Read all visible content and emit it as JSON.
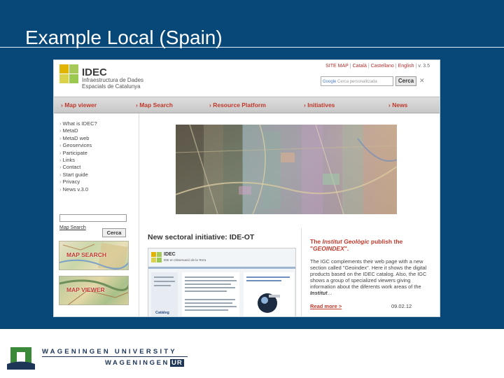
{
  "slide": {
    "title": "Example Local (Spain)"
  },
  "site": {
    "logo": {
      "name": "IDEC",
      "line1": "Infraestructura de Dades",
      "line2": "Espacials de Catalunya"
    },
    "top_links": [
      "SITE MAP",
      "Català",
      "Castellano",
      "English",
      "v. 3.5"
    ],
    "search": {
      "google": "Google",
      "placeholder": "Cerca personalitzada",
      "button": "Cerca"
    },
    "nav": [
      "Map viewer",
      "Map Search",
      "Resource Platform",
      "Initiatives",
      "News"
    ],
    "menu": [
      "What is IDEC?",
      "MetaD",
      "MetaD web",
      "Geoservices",
      "Participate",
      "Links",
      "Contact",
      "Start guide",
      "Privacy",
      "News v.3.0"
    ],
    "left": {
      "map_search_link": "Map Search",
      "search_button": "Cerca"
    },
    "banners": {
      "map_search": "MAP SEARCH",
      "map_viewer": "MAP VIEWER"
    },
    "news_left": {
      "title": "New sectoral initiative: IDE-OT",
      "thumb_logo": "IDEC",
      "thumb_sub": "IDE en Observació de la Terra",
      "thumb_catalog": "Catàleg"
    },
    "news_right": {
      "title_pre": "The ",
      "title_em": "Institut Geològic",
      "title_mid": " publish the \"",
      "title_em2": "GEOINDEX",
      "title_end": "\".",
      "body_1": "The IGC complements their web page with a new section called \"Geoindex\". Here it shows the digital products based on the IDEC catalog. Also, the IGC shows a group of specialized viewers giving information about the diferents work areas of the ",
      "body_em": "Institut",
      "body_2": "…",
      "more": "Read more >",
      "date": "09.02.12"
    }
  },
  "footer": {
    "line1": "WAGENINGEN UNIVERSITY",
    "line2": "WAGENINGEN",
    "ur": "UR"
  },
  "colors": {
    "slide_bg": "#084878",
    "accent_red": "#c0392b",
    "wur_navy": "#1d3557",
    "wur_green": "#3a8a3a"
  }
}
